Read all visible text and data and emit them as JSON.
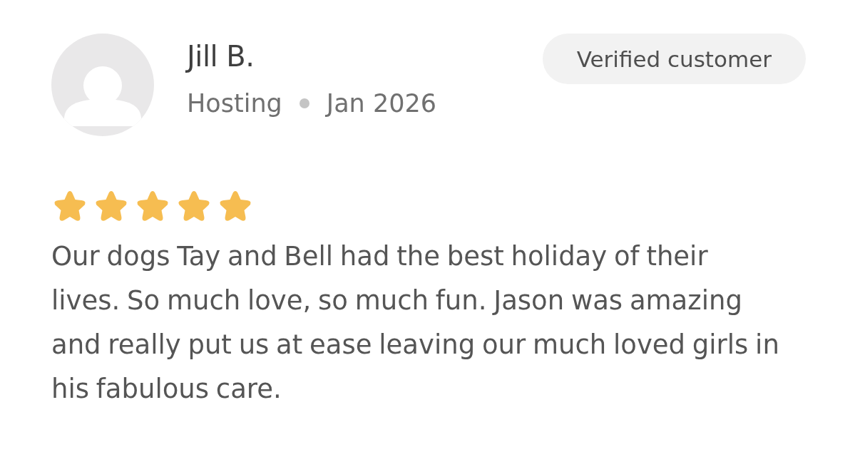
{
  "review": {
    "author": {
      "name": "Jill B.",
      "service": "Hosting",
      "date": "Jan 2026"
    },
    "badge": "Verified customer",
    "stars": 5,
    "text": "Our dogs Tay and Bell had the best holiday of their lives. So much love, so much fun. Jason was amazing and really put us at ease leaving our much loved girls in his fabulous care."
  }
}
